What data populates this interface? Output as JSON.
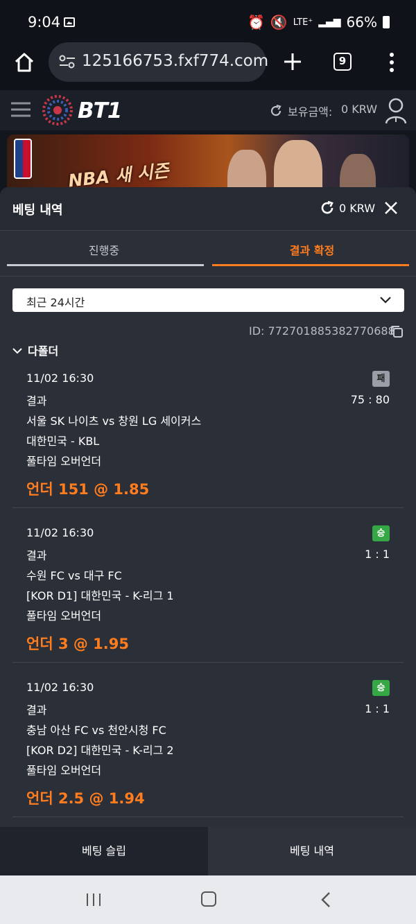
{
  "status_bar": {
    "time": "9:04",
    "network": "LTE⁺",
    "battery": "66%"
  },
  "browser": {
    "url": "125166753.fxf774.com",
    "tab_count": "9"
  },
  "site": {
    "logo_text": "BT1",
    "balance_label": "보유금액:",
    "balance_value": "0 KRW"
  },
  "banner": {
    "text": "NBA 새 시즌"
  },
  "sheet": {
    "title": "베팅 내역",
    "balance": "0 KRW",
    "tabs": [
      {
        "label": "진행중"
      },
      {
        "label": "결과 확정"
      }
    ],
    "active_tab": 1,
    "filter": {
      "value": "최근 24시간"
    },
    "ticket_id": "ID: 772701885382770688",
    "group_label": "다폴더",
    "bets": [
      {
        "datetime": "11/02 16:30",
        "result_label": "결과",
        "badge": "패",
        "score": "75 : 80",
        "match": "서울 SK 나이츠 vs 창원 LG 세이커스",
        "league": "대한민국 - KBL",
        "market": "풀타임 오버언더",
        "pick": "언더 151 @ 1.85"
      },
      {
        "datetime": "11/02 16:30",
        "result_label": "결과",
        "badge": "승",
        "score": "1 : 1",
        "match": "수원 FC vs 대구 FC",
        "league": "[KOR D1] 대한민국 - K-리그 1",
        "market": "풀타임 오버언더",
        "pick": "언더 3 @ 1.95"
      },
      {
        "datetime": "11/02 16:30",
        "result_label": "결과",
        "badge": "승",
        "score": "1 : 1",
        "match": "충남 아산 FC vs 천안시청 FC",
        "league": "[KOR D2] 대한민국 - K-리그 2",
        "market": "풀타임 오버언더",
        "pick": "언더 2.5 @ 1.94"
      }
    ]
  },
  "bottom_bar": {
    "bet_slip": "베팅 슬립",
    "bet_history": "베팅 내역"
  },
  "colors": {
    "accent": "#ff7d1e",
    "win": "#35a845",
    "loss": "#9a9ea6",
    "sheet_bg": "#2b2f38"
  }
}
